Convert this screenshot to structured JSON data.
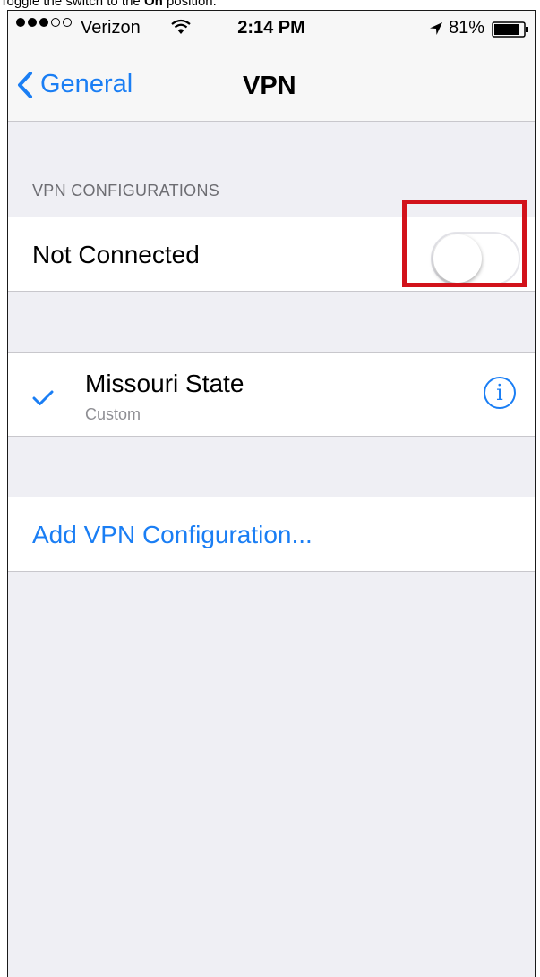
{
  "caption": {
    "prefix": "Toggle the switch to the ",
    "bold": "On",
    "suffix": " position."
  },
  "status_bar": {
    "carrier": "Verizon",
    "time": "2:14 PM",
    "battery": "81%",
    "signal_bars_filled": 3,
    "signal_bars_total": 5,
    "icons": [
      "wifi-icon",
      "location-arrow-icon",
      "battery-icon"
    ]
  },
  "nav": {
    "back_label": "General",
    "title": "VPN"
  },
  "vpn_configurations": {
    "header": "VPN CONFIGURATIONS",
    "status_label": "Not Connected",
    "toggle_on": false
  },
  "configuration": {
    "name": "Missouri State",
    "type": "Custom",
    "selected": true,
    "info_glyph": "i"
  },
  "add_configuration_label": "Add VPN Configuration...",
  "colors": {
    "accent": "#1a7ef4",
    "highlight": "#d2121b",
    "background": "#efeff4"
  }
}
